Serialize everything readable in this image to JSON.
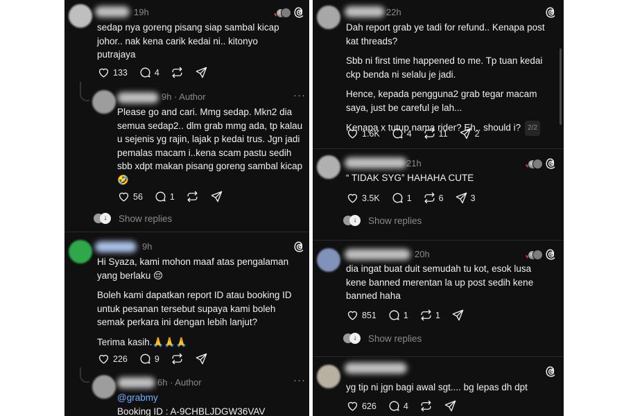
{
  "left": {
    "posts": [
      {
        "time": "19h",
        "text": [
          "sedap nya goreng pisang siap sambal kicap johor.. nak kena carik kedai ni.. kitonyo putrajaya"
        ],
        "likes": "133",
        "replies": "4",
        "reposts": "",
        "shares": ""
      },
      {
        "time": "9h · Author",
        "text": [
          "Please go and cari. Mmg sedap. Mkn2 dia semua sedap2.. dlm grab mmg ada, tp kalau u sejenis yg rajin, lajak p kedai trus. Jgn jadi pemalas macam i..kena scam pastu sedih sbb xdpt makan pisang goreng sambal kicap 🤣"
        ],
        "likes": "56",
        "replies": "1",
        "reposts": "",
        "shares": "",
        "show_replies": "Show replies"
      },
      {
        "time": "9h",
        "text": [
          "Hi Syaza, kami mohon maaf atas pengalaman yang berlaku 😔",
          "Boleh kami dapatkan report ID atau booking ID untuk pesanan tersebut supaya kami boleh semak perkara ini dengan lebih lanjut?",
          "Terima kasih.🙏🙏🙏"
        ],
        "likes": "226",
        "replies": "9",
        "reposts": "",
        "shares": ""
      },
      {
        "time": "6h · Author",
        "mention": "@grabmy",
        "text": [
          "Booking ID : A-9CHBLJDGW36VAV"
        ]
      }
    ]
  },
  "right": {
    "posts": [
      {
        "time": "22h",
        "text": [
          "Dah report grab ye tadi for refund.. Kenapa post kat threads?",
          "Sbb ni first time happened to me. Tp tuan kedai ckp benda ni selalu je jadi.",
          "Hence, kepada pengguna2 grab tegar macam saya, just be careful je lah...",
          "Kenapa x tutup nama rider? Eh.. should i?"
        ],
        "page_badge": "2/2",
        "likes": "1.6K",
        "replies": "4",
        "reposts": "11",
        "shares": "2"
      },
      {
        "time": "21h",
        "text": [
          "“ TIDAK SYG” HAHAHA CUTE"
        ],
        "likes": "3.5K",
        "replies": "1",
        "reposts": "6",
        "shares": "3",
        "show_replies": "Show replies"
      },
      {
        "time": "20h",
        "text": [
          "dia ingat buat duit semudah tu kot, esok lusa kene banned merentan la up post sedih kene banned haha"
        ],
        "likes": "851",
        "replies": "1",
        "reposts": "1",
        "shares": "",
        "show_replies": "Show replies"
      },
      {
        "time": "",
        "text": [
          "yg tip ni jgn bagi awal sgt.... bg lepas dh dpt"
        ],
        "likes": "626",
        "replies": "4",
        "reposts": "",
        "shares": ""
      }
    ]
  },
  "icons": {
    "like": "heart-icon",
    "reply": "speech-bubble-icon",
    "repost": "repost-arrows-icon",
    "share": "paper-plane-icon",
    "threads": "threads-logo-icon",
    "more": "ellipsis-icon"
  },
  "colors": {
    "background": "#101010",
    "text": "#f0f0f0",
    "muted": "#8a8a8a",
    "mention": "#6fb2ff",
    "heart": "#ff3040"
  }
}
